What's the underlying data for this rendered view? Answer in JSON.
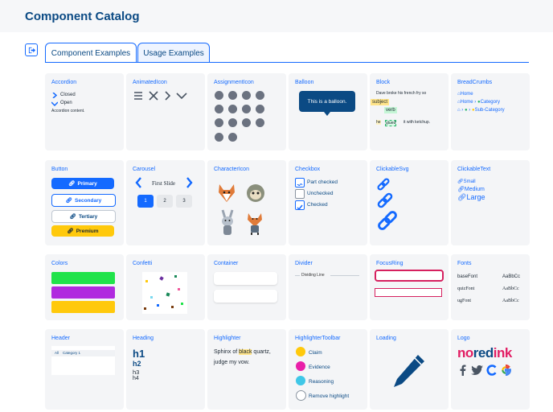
{
  "header": {
    "title": "Component Catalog"
  },
  "tabs": [
    {
      "label": "Component Examples"
    },
    {
      "label": "Usage Examples"
    }
  ],
  "cards": {
    "accordion": {
      "title": "Accordion",
      "closed": "Closed",
      "open": "Open",
      "content": "Accordion content."
    },
    "animatedicon": {
      "title": "AnimatedIcon"
    },
    "assignmenticon": {
      "title": "AssignmentIcon"
    },
    "balloon": {
      "title": "Balloon",
      "text": "This is a balloon."
    },
    "block": {
      "title": "Block",
      "sentence": "Dave broke his french fry so",
      "subject": "subject",
      "verb": "verb",
      "he": "he",
      "glued": "glued",
      "rest": "it with ketchup."
    },
    "breadcrumbs": {
      "title": "BreadCrumbs",
      "home": "Home",
      "category": "Category",
      "subcategory": "Sub-Category"
    },
    "button": {
      "title": "Button",
      "primary": "Primary",
      "secondary": "Secondary",
      "tertiary": "Tertiary",
      "premium": "Premium"
    },
    "carousel": {
      "title": "Carousel",
      "slide": "First Slide",
      "pages": [
        "1",
        "2",
        "3"
      ]
    },
    "charactericon": {
      "title": "CharacterIcon"
    },
    "checkbox": {
      "title": "Checkbox",
      "partial": "Part checked",
      "unchecked": "Unchecked",
      "checked": "Checked"
    },
    "clickablesvg": {
      "title": "ClickableSvg"
    },
    "clickabletext": {
      "title": "ClickableText",
      "small": "Small",
      "medium": "Medium",
      "large": "Large"
    },
    "colors": {
      "title": "Colors",
      "swatches": [
        "#20e34a",
        "#b02adf",
        "#ffc90c"
      ]
    },
    "confetti": {
      "title": "Confetti"
    },
    "container": {
      "title": "Container"
    },
    "divider": {
      "title": "Divider",
      "label": "Dividing Line"
    },
    "focusring": {
      "title": "FocusRing"
    },
    "fonts": {
      "title": "Fonts",
      "rows": [
        [
          "baseFont",
          "AaBbCc"
        ],
        [
          "quizFont",
          "AaBbCc"
        ],
        [
          "ugFont",
          "AaBbCc"
        ]
      ]
    },
    "headercard": {
      "title": "Header",
      "all": "All",
      "category": "Category 1"
    },
    "heading": {
      "title": "Heading",
      "h1": "h1",
      "h2": "h2",
      "h3": "h3",
      "h4": "h4"
    },
    "highlighter": {
      "title": "Highlighter",
      "pre": "Sphinx of ",
      "mark": "black",
      "post": " quartz,",
      "line2": "judge my vow."
    },
    "highlightertoolbar": {
      "title": "HighlighterToolbar",
      "claim": "Claim",
      "evidence": "Evidence",
      "reasoning": "Reasoning",
      "remove": "Remove highlight"
    },
    "loading": {
      "title": "Loading"
    },
    "logo": {
      "title": "Logo",
      "no": "no",
      "red": "red",
      "ink": "ink"
    }
  }
}
